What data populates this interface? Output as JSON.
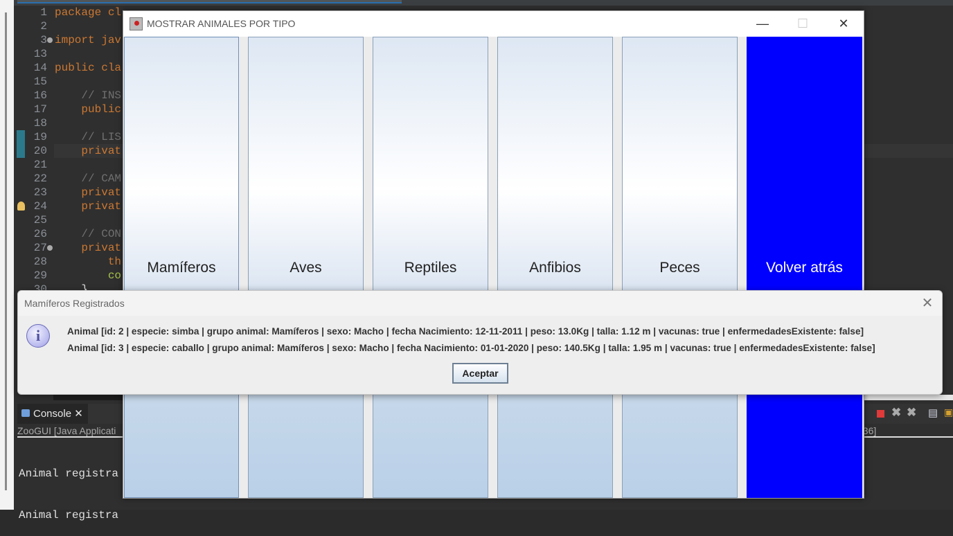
{
  "editor": {
    "lines": [
      {
        "n": "1",
        "text": "package cl",
        "kind": "code",
        "marker": ""
      },
      {
        "n": "2",
        "text": "",
        "kind": "code",
        "marker": ""
      },
      {
        "n": "3",
        "text": "import jav",
        "kind": "code",
        "marker": "expand"
      },
      {
        "n": "13",
        "text": "",
        "kind": "code",
        "marker": ""
      },
      {
        "n": "14",
        "text": "public cla",
        "kind": "code",
        "marker": ""
      },
      {
        "n": "15",
        "text": "",
        "kind": "code",
        "marker": ""
      },
      {
        "n": "16",
        "text": "    // INS",
        "kind": "comment",
        "marker": ""
      },
      {
        "n": "17",
        "text": "    public",
        "kind": "code",
        "marker": ""
      },
      {
        "n": "18",
        "text": "",
        "kind": "code",
        "marker": ""
      },
      {
        "n": "19",
        "text": "    // LIS",
        "kind": "comment",
        "marker": ""
      },
      {
        "n": "20",
        "text": "    privat",
        "kind": "code",
        "marker": ""
      },
      {
        "n": "21",
        "text": "",
        "kind": "code",
        "marker": ""
      },
      {
        "n": "22",
        "text": "    // CAM",
        "kind": "comment",
        "marker": ""
      },
      {
        "n": "23",
        "text": "    privat",
        "kind": "code",
        "marker": ""
      },
      {
        "n": "24",
        "text": "    privat",
        "kind": "code",
        "marker": "warning"
      },
      {
        "n": "25",
        "text": "",
        "kind": "code",
        "marker": ""
      },
      {
        "n": "26",
        "text": "    // CON",
        "kind": "comment",
        "marker": ""
      },
      {
        "n": "27",
        "text": "    privat",
        "kind": "code",
        "marker": "collapse"
      },
      {
        "n": "28",
        "text": "        th",
        "kind": "code",
        "marker": ""
      },
      {
        "n": "29",
        "text": "        co",
        "kind": "green",
        "marker": ""
      },
      {
        "n": "30",
        "text": "    }",
        "kind": "plain",
        "marker": ""
      }
    ]
  },
  "console": {
    "tab_label": "Console",
    "launch_line": "ZooGUI [Java Applicati",
    "launch_line_end": "636]",
    "output": [
      "Animal registra",
      "Animal registra"
    ]
  },
  "frame": {
    "title": "MOSTRAR ANIMALES POR TIPO",
    "buttons": [
      "Mamíferos",
      "Aves",
      "Reptiles",
      "Anfibios",
      "Peces",
      "Volver atrás"
    ],
    "back_color": "#0000ff"
  },
  "dialog": {
    "title": "Mamíferos Registrados",
    "messages": [
      "Animal [id: 2 | especie: simba | grupo animal: Mamíferos | sexo: Macho | fecha Nacimiento: 12-11-2011 | peso: 13.0Kg | talla: 1.12 m | vacunas: true | enfermedadesExistente: false]",
      "Animal [id: 3 | especie: caballo | grupo animal: Mamíferos | sexo: Macho | fecha Nacimiento: 01-01-2020 | peso: 140.5Kg | talla: 1.95 m | vacunas: true | enfermedadesExistente: false]"
    ],
    "ok_label": "Aceptar",
    "icon": "info-icon"
  }
}
